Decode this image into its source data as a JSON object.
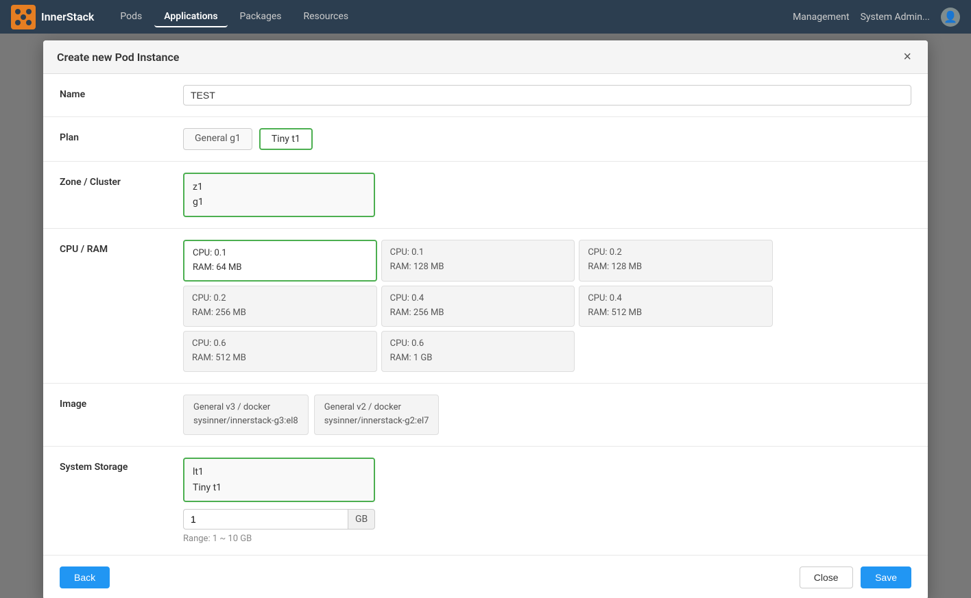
{
  "navbar": {
    "logo_text": "InnerStack",
    "nav_items": [
      {
        "label": "Pods",
        "active": false
      },
      {
        "label": "Applications",
        "active": true
      },
      {
        "label": "Packages",
        "active": false
      },
      {
        "label": "Resources",
        "active": false
      }
    ],
    "right_items": [
      "Management",
      "System Admin..."
    ]
  },
  "modal": {
    "title": "Create new Pod Instance",
    "close_label": "×",
    "fields": {
      "name": {
        "label": "Name",
        "value": "TEST"
      },
      "plan": {
        "label": "Plan",
        "options": [
          {
            "label": "General g1",
            "selected": false
          },
          {
            "label": "Tiny t1",
            "selected": true
          }
        ]
      },
      "zone_cluster": {
        "label": "Zone / Cluster",
        "selected_line1": "z1",
        "selected_line2": "g1"
      },
      "cpu_ram": {
        "label": "CPU / RAM",
        "options": [
          {
            "cpu": "CPU: 0.1",
            "ram": "RAM: 64 MB",
            "selected": true
          },
          {
            "cpu": "CPU: 0.1",
            "ram": "RAM: 128 MB",
            "selected": false
          },
          {
            "cpu": "CPU: 0.2",
            "ram": "RAM: 128 MB",
            "selected": false
          },
          {
            "cpu": "CPU: 0.2",
            "ram": "RAM: 256 MB",
            "selected": false
          },
          {
            "cpu": "CPU: 0.4",
            "ram": "RAM: 256 MB",
            "selected": false
          },
          {
            "cpu": "CPU: 0.4",
            "ram": "RAM: 512 MB",
            "selected": false
          },
          {
            "cpu": "CPU: 0.6",
            "ram": "RAM: 512 MB",
            "selected": false
          },
          {
            "cpu": "CPU: 0.6",
            "ram": "RAM: 1 GB",
            "selected": false
          },
          {
            "cpu": "",
            "ram": "",
            "selected": false,
            "empty": true
          }
        ]
      },
      "image": {
        "label": "Image",
        "options": [
          {
            "line1": "General v3 / docker",
            "line2": "sysinner/innerstack-g3:el8",
            "selected": false
          },
          {
            "line1": "General v2 / docker",
            "line2": "sysinner/innerstack-g2:el7",
            "selected": false
          }
        ]
      },
      "system_storage": {
        "label": "System Storage",
        "type_line1": "lt1",
        "type_line2": "Tiny t1",
        "size_value": "1",
        "size_unit": "GB",
        "range_text": "Range: 1 ~ 10 GB"
      }
    },
    "buttons": {
      "back": "Back",
      "close": "Close",
      "save": "Save"
    }
  }
}
